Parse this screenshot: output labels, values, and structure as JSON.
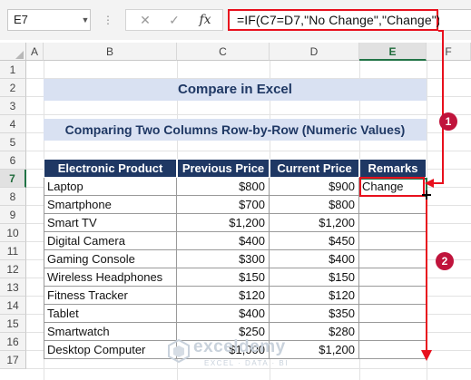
{
  "formula_bar": {
    "name_box": "E7",
    "cancel_icon": "✕",
    "enter_icon": "✓",
    "fx_label": "fx",
    "formula": "=IF(C7=D7,\"No Change\",\"Change\")"
  },
  "columns": [
    "A",
    "B",
    "C",
    "D",
    "E",
    "F"
  ],
  "rows": [
    "1",
    "2",
    "3",
    "4",
    "5",
    "6",
    "7",
    "8",
    "9",
    "10",
    "11",
    "12",
    "13",
    "14",
    "15",
    "16",
    "17"
  ],
  "sheet": {
    "title": "Compare in Excel",
    "subtitle": "Comparing Two Columns Row-by-Row (Numeric Values)",
    "headers": [
      "Electronic Product",
      "Previous Price",
      "Current Price",
      "Remarks"
    ],
    "data": [
      {
        "product": "Laptop",
        "previous": "$800",
        "current": "$900",
        "remarks": "Change"
      },
      {
        "product": "Smartphone",
        "previous": "$700",
        "current": "$800",
        "remarks": ""
      },
      {
        "product": "Smart TV",
        "previous": "$1,200",
        "current": "$1,200",
        "remarks": ""
      },
      {
        "product": "Digital Camera",
        "previous": "$400",
        "current": "$450",
        "remarks": ""
      },
      {
        "product": "Gaming Console",
        "previous": "$300",
        "current": "$400",
        "remarks": ""
      },
      {
        "product": "Wireless Headphones",
        "previous": "$150",
        "current": "$150",
        "remarks": ""
      },
      {
        "product": "Fitness Tracker",
        "previous": "$120",
        "current": "$120",
        "remarks": ""
      },
      {
        "product": "Tablet",
        "previous": "$400",
        "current": "$350",
        "remarks": ""
      },
      {
        "product": "Smartwatch",
        "previous": "$250",
        "current": "$280",
        "remarks": ""
      },
      {
        "product": "Desktop Computer",
        "previous": "$1,000",
        "current": "$1,200",
        "remarks": ""
      }
    ]
  },
  "annotations": {
    "step1": "1",
    "step2": "2",
    "watermark_name": "exceldemy",
    "watermark_tagline": "EXCEL · DATA · BI",
    "accent_red": "#e8101d",
    "header_navy": "#1f3864",
    "title_band": "#d9e1f2",
    "badge_color": "#c0143c",
    "select_green": "#217346"
  }
}
